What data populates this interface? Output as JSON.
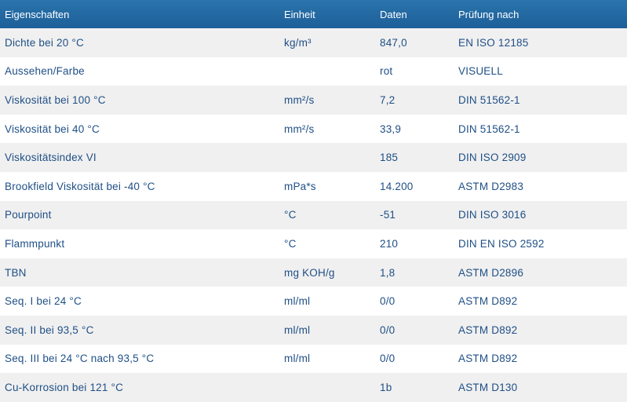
{
  "header": {
    "property": "Eigenschaften",
    "unit": "Einheit",
    "value": "Daten",
    "test": "Prüfung nach"
  },
  "rows": [
    {
      "property": "Dichte bei 20 °C",
      "unit": "kg/m³",
      "value": "847,0",
      "test": "EN ISO 12185"
    },
    {
      "property": "Aussehen/Farbe",
      "unit": "",
      "value": "rot",
      "test": "VISUELL"
    },
    {
      "property": "Viskosität bei 100 °C",
      "unit": "mm²/s",
      "value": "7,2",
      "test": "DIN 51562-1"
    },
    {
      "property": "Viskosität bei 40 °C",
      "unit": "mm²/s",
      "value": "33,9",
      "test": "DIN 51562-1"
    },
    {
      "property": "Viskositätsindex VI",
      "unit": "",
      "value": "185",
      "test": "DIN ISO 2909"
    },
    {
      "property": "Brookfield Viskosität bei -40 °C",
      "unit": "mPa*s",
      "value": "14.200",
      "test": "ASTM D2983"
    },
    {
      "property": "Pourpoint",
      "unit": "°C",
      "value": "-51",
      "test": "DIN ISO 3016"
    },
    {
      "property": "Flammpunkt",
      "unit": "°C",
      "value": "210",
      "test": "DIN EN ISO 2592"
    },
    {
      "property": "TBN",
      "unit": "mg KOH/g",
      "value": "1,8",
      "test": "ASTM D2896"
    },
    {
      "property": "Seq. I bei 24 °C",
      "unit": "ml/ml",
      "value": "0/0",
      "test": "ASTM D892"
    },
    {
      "property": "Seq. II bei 93,5 °C",
      "unit": "ml/ml",
      "value": "0/0",
      "test": "ASTM D892"
    },
    {
      "property": "Seq. III bei 24 °C nach 93,5 °C",
      "unit": "ml/ml",
      "value": "0/0",
      "test": "ASTM D892"
    },
    {
      "property": "Cu-Korrosion bei 121 °C",
      "unit": "",
      "value": "1b",
      "test": "ASTM D130"
    }
  ]
}
